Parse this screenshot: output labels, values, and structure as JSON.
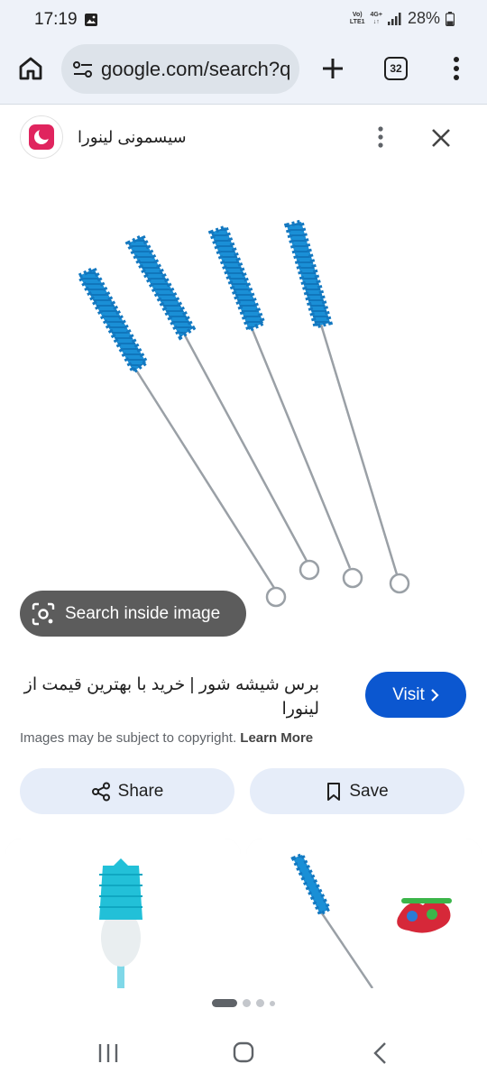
{
  "status": {
    "time": "17:19",
    "net_top": "Vo)",
    "net_bottom": "LTE1",
    "net_gen": "4G+",
    "battery": "28%"
  },
  "browser": {
    "url": "google.com/search?q",
    "tab_count": "32"
  },
  "source": {
    "name": "سیسمونی لینورا"
  },
  "image_actions": {
    "search_inside_label": "Search inside image"
  },
  "result": {
    "title": "برس شیشه شور | خرید با بهترین قیمت از لینورا",
    "visit_label": "Visit",
    "copyright_text": "Images may be subject to copyright.",
    "learn_more": "Learn More"
  },
  "actions": {
    "share_label": "Share",
    "save_label": "Save"
  },
  "colors": {
    "accent": "#0b57d0",
    "brush": "#1a8fd6",
    "chrome_bg": "#eef2f9"
  }
}
